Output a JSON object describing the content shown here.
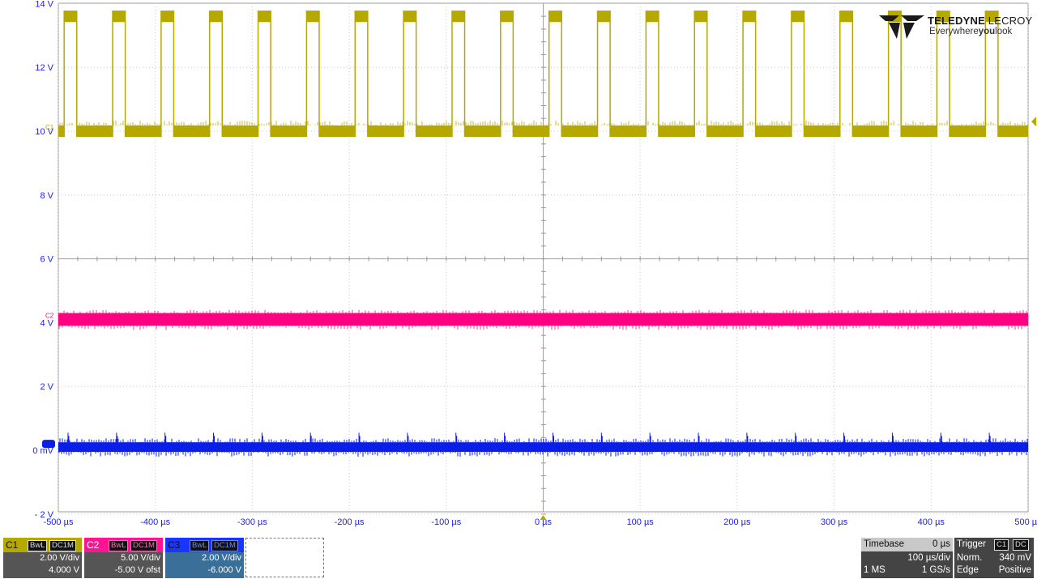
{
  "chart_data": {
    "type": "line",
    "title": "",
    "xlabel": "",
    "ylabel": "",
    "x_range": [
      -500,
      500
    ],
    "x_unit": "µs",
    "y_range": [
      -2,
      14
    ],
    "grid": true,
    "x_ticks": [
      "-500 µs",
      "-400 µs",
      "-300 µs",
      "-200 µs",
      "-100 µs",
      "0 µs",
      "100 µs",
      "200 µs",
      "300 µs",
      "400 µs",
      "500 µs"
    ],
    "y_ticks": [
      "14 V",
      "12 V",
      "10 V",
      "8 V",
      "6 V",
      "4 V",
      "2 V",
      "0 mV",
      "- 2 V"
    ],
    "y_tick_values": [
      14,
      12,
      10,
      8,
      6,
      4,
      2,
      0,
      -2
    ],
    "series": [
      {
        "name": "C1",
        "color": "#b5a800",
        "kind": "square",
        "low_v": 10.0,
        "high_v": 13.6,
        "period_us": 50,
        "high_duration_us": 13,
        "first_rise_us": -494
      },
      {
        "name": "C2",
        "color": "#ff0080",
        "kind": "flat",
        "level_v": 4.1
      },
      {
        "name": "C3",
        "color": "#0a1ee6",
        "kind": "flat_with_spikes",
        "level_v": 0.1,
        "spike_v": 0.55,
        "period_us": 50,
        "first_spike_us": -490
      }
    ]
  },
  "logo": {
    "brand": "TELEDYNE",
    "brand2": "LECROY",
    "tag_pre": "Everywhere",
    "tag_bold": "you",
    "tag_post": "look"
  },
  "channels": [
    {
      "id": "C1",
      "bw": "BwL",
      "coupling": "DC1M",
      "vdiv": "2.00 V/div",
      "offset": "4.000 V",
      "head_color": "#b5a800",
      "body_color": "#555555"
    },
    {
      "id": "C2",
      "bw": "BwL",
      "coupling": "DC1M",
      "vdiv": "5.00 V/div",
      "offset": "-5.00 V ofst",
      "head_color": "#ff1493",
      "body_color": "#555555"
    },
    {
      "id": "C3",
      "bw": "BwL",
      "coupling": "DC1M",
      "vdiv": "2.00 V/div",
      "offset": "-6.000 V",
      "head_color": "#1a35ff",
      "body_color": "#3a6f9a"
    }
  ],
  "timebase": {
    "label": "Timebase",
    "delay": "0 µs",
    "per_div": "100 µs/div",
    "mem": "1 MS",
    "rate": "1 GS/s"
  },
  "trigger": {
    "label": "Trigger",
    "ch": "C1",
    "coupling": "DC",
    "mode": "Norm.",
    "level": "340 mV",
    "type": "Edge",
    "slope": "Positive"
  }
}
